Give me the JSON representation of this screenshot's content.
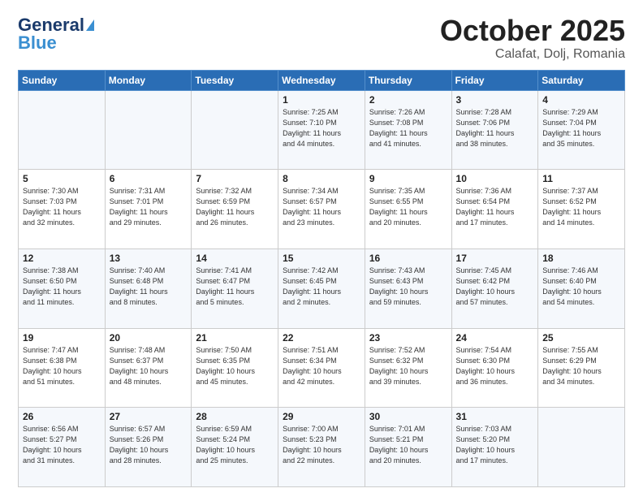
{
  "header": {
    "logo_line1": "General",
    "logo_line2": "Blue",
    "title": "October 2025",
    "subtitle": "Calafat, Dolj, Romania"
  },
  "weekdays": [
    "Sunday",
    "Monday",
    "Tuesday",
    "Wednesday",
    "Thursday",
    "Friday",
    "Saturday"
  ],
  "weeks": [
    [
      {
        "day": "",
        "info": ""
      },
      {
        "day": "",
        "info": ""
      },
      {
        "day": "",
        "info": ""
      },
      {
        "day": "1",
        "info": "Sunrise: 7:25 AM\nSunset: 7:10 PM\nDaylight: 11 hours\nand 44 minutes."
      },
      {
        "day": "2",
        "info": "Sunrise: 7:26 AM\nSunset: 7:08 PM\nDaylight: 11 hours\nand 41 minutes."
      },
      {
        "day": "3",
        "info": "Sunrise: 7:28 AM\nSunset: 7:06 PM\nDaylight: 11 hours\nand 38 minutes."
      },
      {
        "day": "4",
        "info": "Sunrise: 7:29 AM\nSunset: 7:04 PM\nDaylight: 11 hours\nand 35 minutes."
      }
    ],
    [
      {
        "day": "5",
        "info": "Sunrise: 7:30 AM\nSunset: 7:03 PM\nDaylight: 11 hours\nand 32 minutes."
      },
      {
        "day": "6",
        "info": "Sunrise: 7:31 AM\nSunset: 7:01 PM\nDaylight: 11 hours\nand 29 minutes."
      },
      {
        "day": "7",
        "info": "Sunrise: 7:32 AM\nSunset: 6:59 PM\nDaylight: 11 hours\nand 26 minutes."
      },
      {
        "day": "8",
        "info": "Sunrise: 7:34 AM\nSunset: 6:57 PM\nDaylight: 11 hours\nand 23 minutes."
      },
      {
        "day": "9",
        "info": "Sunrise: 7:35 AM\nSunset: 6:55 PM\nDaylight: 11 hours\nand 20 minutes."
      },
      {
        "day": "10",
        "info": "Sunrise: 7:36 AM\nSunset: 6:54 PM\nDaylight: 11 hours\nand 17 minutes."
      },
      {
        "day": "11",
        "info": "Sunrise: 7:37 AM\nSunset: 6:52 PM\nDaylight: 11 hours\nand 14 minutes."
      }
    ],
    [
      {
        "day": "12",
        "info": "Sunrise: 7:38 AM\nSunset: 6:50 PM\nDaylight: 11 hours\nand 11 minutes."
      },
      {
        "day": "13",
        "info": "Sunrise: 7:40 AM\nSunset: 6:48 PM\nDaylight: 11 hours\nand 8 minutes."
      },
      {
        "day": "14",
        "info": "Sunrise: 7:41 AM\nSunset: 6:47 PM\nDaylight: 11 hours\nand 5 minutes."
      },
      {
        "day": "15",
        "info": "Sunrise: 7:42 AM\nSunset: 6:45 PM\nDaylight: 11 hours\nand 2 minutes."
      },
      {
        "day": "16",
        "info": "Sunrise: 7:43 AM\nSunset: 6:43 PM\nDaylight: 10 hours\nand 59 minutes."
      },
      {
        "day": "17",
        "info": "Sunrise: 7:45 AM\nSunset: 6:42 PM\nDaylight: 10 hours\nand 57 minutes."
      },
      {
        "day": "18",
        "info": "Sunrise: 7:46 AM\nSunset: 6:40 PM\nDaylight: 10 hours\nand 54 minutes."
      }
    ],
    [
      {
        "day": "19",
        "info": "Sunrise: 7:47 AM\nSunset: 6:38 PM\nDaylight: 10 hours\nand 51 minutes."
      },
      {
        "day": "20",
        "info": "Sunrise: 7:48 AM\nSunset: 6:37 PM\nDaylight: 10 hours\nand 48 minutes."
      },
      {
        "day": "21",
        "info": "Sunrise: 7:50 AM\nSunset: 6:35 PM\nDaylight: 10 hours\nand 45 minutes."
      },
      {
        "day": "22",
        "info": "Sunrise: 7:51 AM\nSunset: 6:34 PM\nDaylight: 10 hours\nand 42 minutes."
      },
      {
        "day": "23",
        "info": "Sunrise: 7:52 AM\nSunset: 6:32 PM\nDaylight: 10 hours\nand 39 minutes."
      },
      {
        "day": "24",
        "info": "Sunrise: 7:54 AM\nSunset: 6:30 PM\nDaylight: 10 hours\nand 36 minutes."
      },
      {
        "day": "25",
        "info": "Sunrise: 7:55 AM\nSunset: 6:29 PM\nDaylight: 10 hours\nand 34 minutes."
      }
    ],
    [
      {
        "day": "26",
        "info": "Sunrise: 6:56 AM\nSunset: 5:27 PM\nDaylight: 10 hours\nand 31 minutes."
      },
      {
        "day": "27",
        "info": "Sunrise: 6:57 AM\nSunset: 5:26 PM\nDaylight: 10 hours\nand 28 minutes."
      },
      {
        "day": "28",
        "info": "Sunrise: 6:59 AM\nSunset: 5:24 PM\nDaylight: 10 hours\nand 25 minutes."
      },
      {
        "day": "29",
        "info": "Sunrise: 7:00 AM\nSunset: 5:23 PM\nDaylight: 10 hours\nand 22 minutes."
      },
      {
        "day": "30",
        "info": "Sunrise: 7:01 AM\nSunset: 5:21 PM\nDaylight: 10 hours\nand 20 minutes."
      },
      {
        "day": "31",
        "info": "Sunrise: 7:03 AM\nSunset: 5:20 PM\nDaylight: 10 hours\nand 17 minutes."
      },
      {
        "day": "",
        "info": ""
      }
    ]
  ]
}
